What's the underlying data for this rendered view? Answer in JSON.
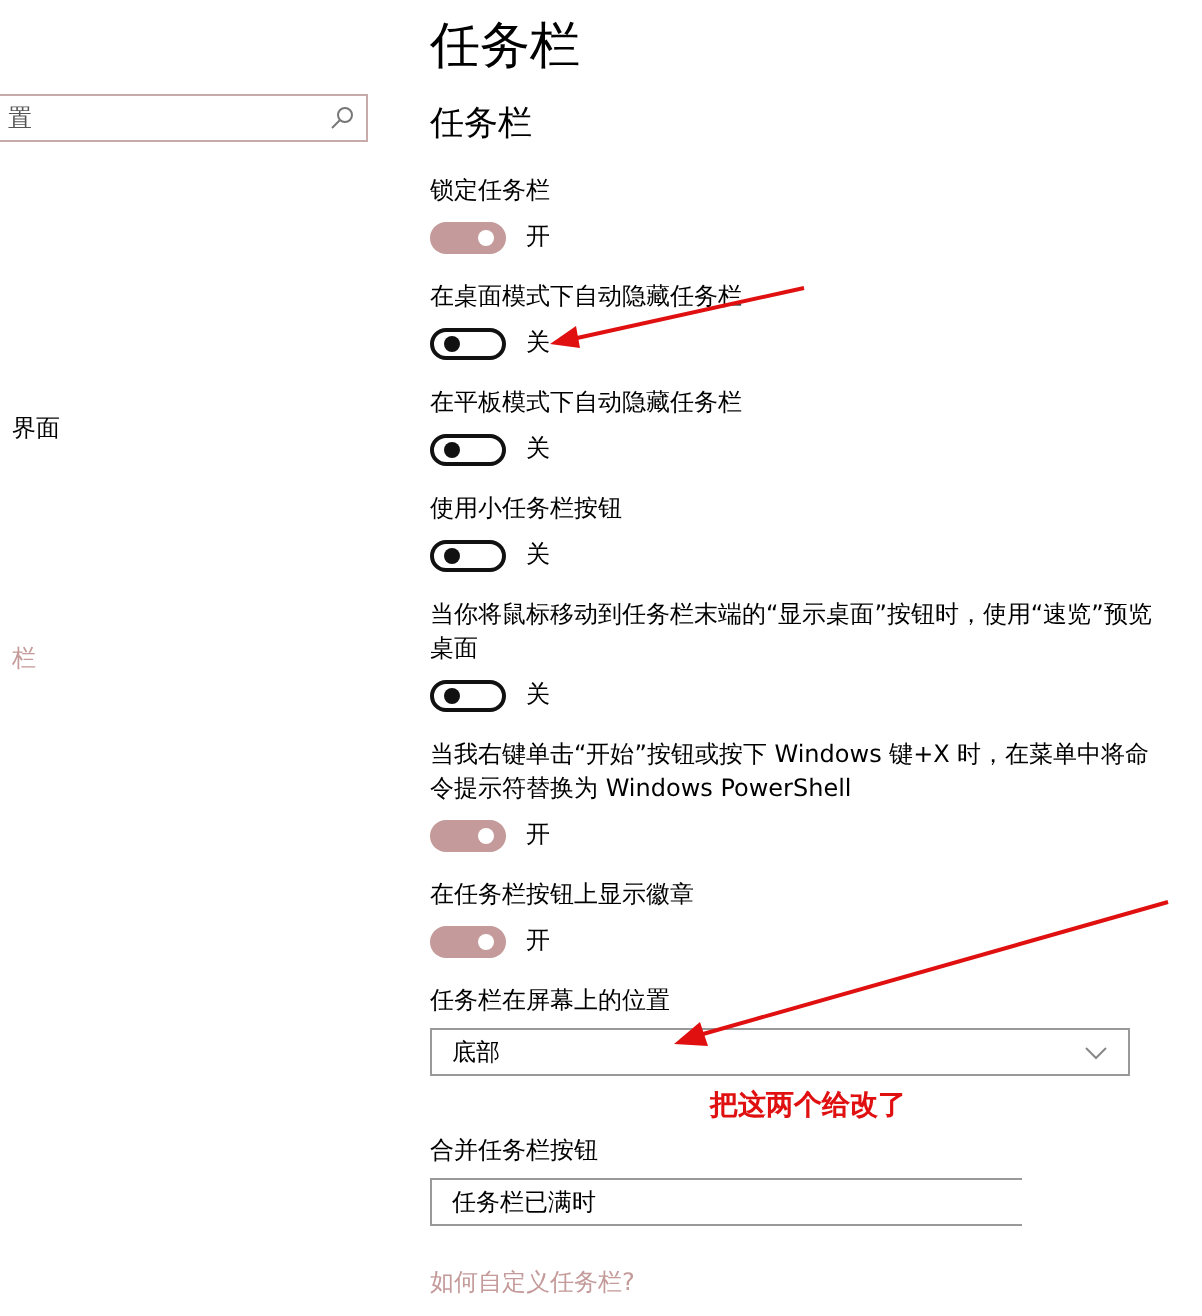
{
  "sidebar": {
    "search": {
      "placeholder": "置"
    },
    "items": [
      {
        "label": "界面",
        "selected": false
      },
      {
        "label": "栏",
        "selected": true
      }
    ]
  },
  "page_title": "任务栏",
  "section_title": "任务栏",
  "settings": [
    {
      "kind": "toggle",
      "label": "锁定任务栏",
      "on": true,
      "state_text": "开"
    },
    {
      "kind": "toggle",
      "label": "在桌面模式下自动隐藏任务栏",
      "on": false,
      "state_text": "关"
    },
    {
      "kind": "toggle",
      "label": "在平板模式下自动隐藏任务栏",
      "on": false,
      "state_text": "关"
    },
    {
      "kind": "toggle",
      "label": "使用小任务栏按钮",
      "on": false,
      "state_text": "关"
    },
    {
      "kind": "toggle",
      "label": "当你将鼠标移动到任务栏末端的“显示桌面”按钮时，使用“速览”预览桌面",
      "on": false,
      "state_text": "关"
    },
    {
      "kind": "toggle",
      "label": "当我右键单击“开始”按钮或按下 Windows 键+X 时，在菜单中将命令提示符替换为 Windows PowerShell",
      "on": true,
      "state_text": "开"
    },
    {
      "kind": "toggle",
      "label": "在任务栏按钮上显示徽章",
      "on": true,
      "state_text": "开"
    },
    {
      "kind": "dropdown",
      "label": "任务栏在屏幕上的位置",
      "value": "底部"
    },
    {
      "kind": "dropdown",
      "label": "合并任务栏按钮",
      "value": "任务栏已满时"
    }
  ],
  "link": "如何自定义任务栏?",
  "annotation": {
    "note": "把这两个给改了"
  }
}
